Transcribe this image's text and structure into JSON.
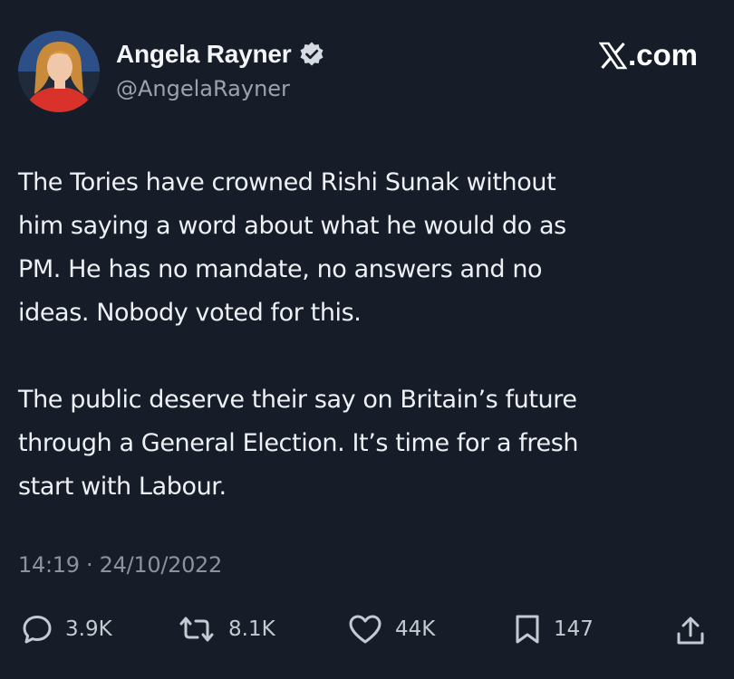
{
  "author": {
    "name": "Angela Rayner",
    "handle": "@AngelaRayner",
    "verified_icon": "verified-badge-icon"
  },
  "site": {
    "label": ".com",
    "logo_icon": "x-logo-icon"
  },
  "tweet": {
    "paragraph_1": "The Tories have crowned Rishi Sunak without\nhim saying a word about what he would do as\nPM. He has no mandate, no answers and no\nideas. Nobody voted for this.",
    "paragraph_2": "The public deserve their say on Britain’s future\nthrough a General Election. It’s time for a fresh\nstart with Labour.",
    "timestamp": "14:19 · 24/10/2022"
  },
  "actions": {
    "replies": "3.9K",
    "reposts": "8.1K",
    "likes": "44K",
    "bookmarks": "147"
  },
  "colors": {
    "background": "#161d29",
    "text": "#eef1f4",
    "muted": "#9aa3ad",
    "avatar_accent": "#d8322b"
  }
}
